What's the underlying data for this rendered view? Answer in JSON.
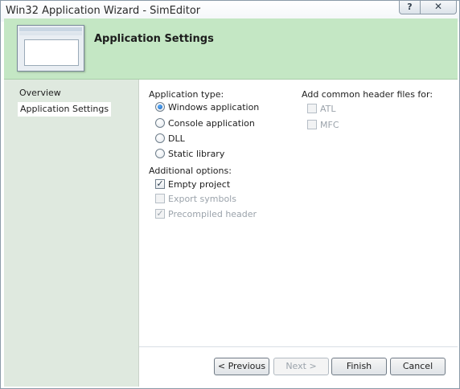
{
  "window": {
    "title": "Win32 Application Wizard - SimEditor",
    "help_glyph": "?",
    "close_glyph": "✕"
  },
  "banner": {
    "title": "Application Settings",
    "background": "#c4e7c4"
  },
  "nav": {
    "items": [
      {
        "label": "Overview",
        "selected": false
      },
      {
        "label": "Application Settings",
        "selected": true
      }
    ]
  },
  "app_type": {
    "label": "Application type:",
    "options": [
      {
        "label": "Windows application",
        "checked": true
      },
      {
        "label": "Console application",
        "checked": false
      },
      {
        "label": "DLL",
        "checked": false
      },
      {
        "label": "Static library",
        "checked": false
      }
    ]
  },
  "additional": {
    "label": "Additional options:",
    "options": [
      {
        "label": "Empty project",
        "checked": true,
        "enabled": true
      },
      {
        "label": "Export symbols",
        "checked": false,
        "enabled": false
      },
      {
        "label": "Precompiled header",
        "checked": true,
        "enabled": false
      }
    ]
  },
  "headers": {
    "label": "Add common header files for:",
    "options": [
      {
        "label": "ATL",
        "checked": false,
        "enabled": false
      },
      {
        "label": "MFC",
        "checked": false,
        "enabled": false
      }
    ]
  },
  "buttons": {
    "previous": "< Previous",
    "next": "Next >",
    "finish": "Finish",
    "cancel": "Cancel"
  },
  "check_glyph": "✓"
}
